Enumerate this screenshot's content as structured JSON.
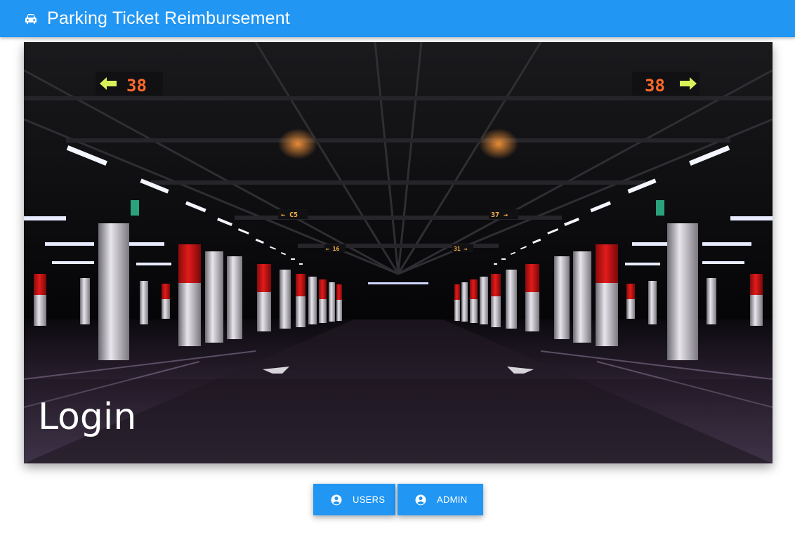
{
  "app": {
    "title": "Parking Ticket Reimbursement",
    "icon": "car-icon",
    "brand_color": "#2196f3"
  },
  "hero": {
    "heading": "Login",
    "image": "parking-garage-photo",
    "signs": {
      "left_top": "38",
      "right_top": "38",
      "left_mid": "← C5",
      "right_mid": "37 →",
      "left_far": "← 16",
      "right_far": "31 →"
    }
  },
  "buttons": [
    {
      "label": "USERS",
      "icon": "account-circle-icon"
    },
    {
      "label": "ADMIN",
      "icon": "account-circle-icon"
    }
  ]
}
